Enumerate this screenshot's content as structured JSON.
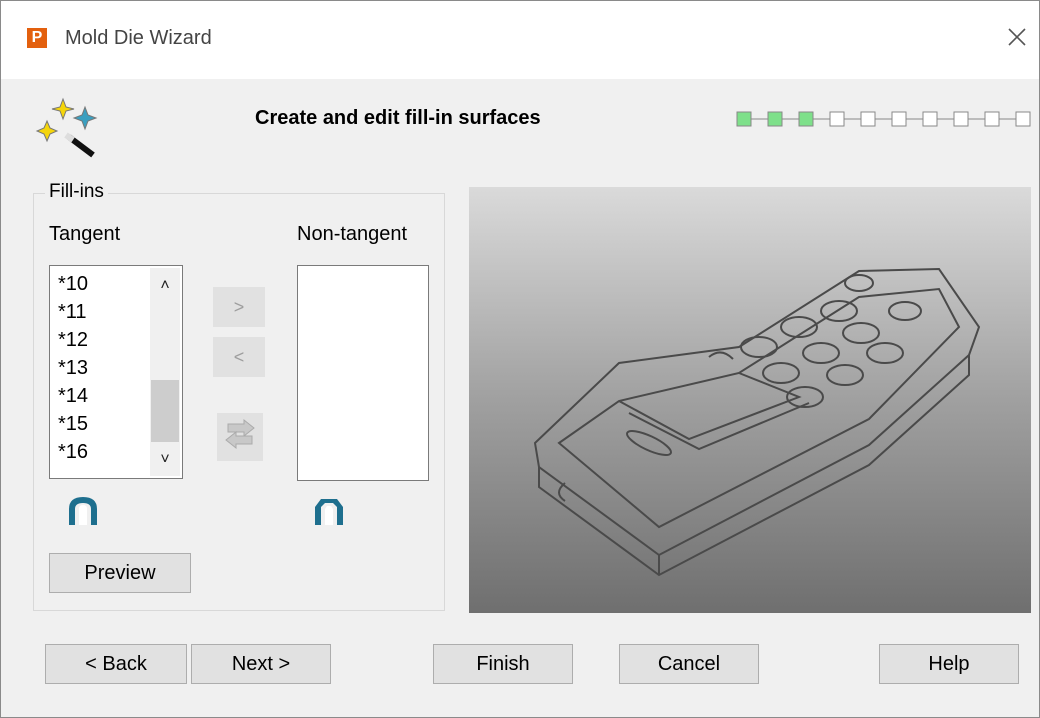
{
  "window": {
    "title": "Mold Die Wizard",
    "app_icon_letter": "P",
    "close_glyph": "×",
    "header_title": "Create and edit fill-in surfaces",
    "steps": {
      "total": 10,
      "completed": 3
    }
  },
  "fillins": {
    "group_label": "Fill-ins",
    "tangent_label": "Tangent",
    "non_tangent_label": "Non-tangent",
    "tangent_items": [
      "*10",
      "*11",
      "*12",
      "*13",
      "*14",
      "*15",
      "*16"
    ],
    "non_tangent_items": [],
    "move_right_label": ">",
    "move_left_label": "<",
    "preview_label": "Preview"
  },
  "buttons": {
    "back": "< Back",
    "next": "Next >",
    "finish": "Finish",
    "cancel": "Cancel",
    "help": "Help"
  },
  "colors": {
    "step_done": "#7ee08a",
    "accent_icon": "#e3600e",
    "fillin_icon": "#1e6f8e"
  }
}
